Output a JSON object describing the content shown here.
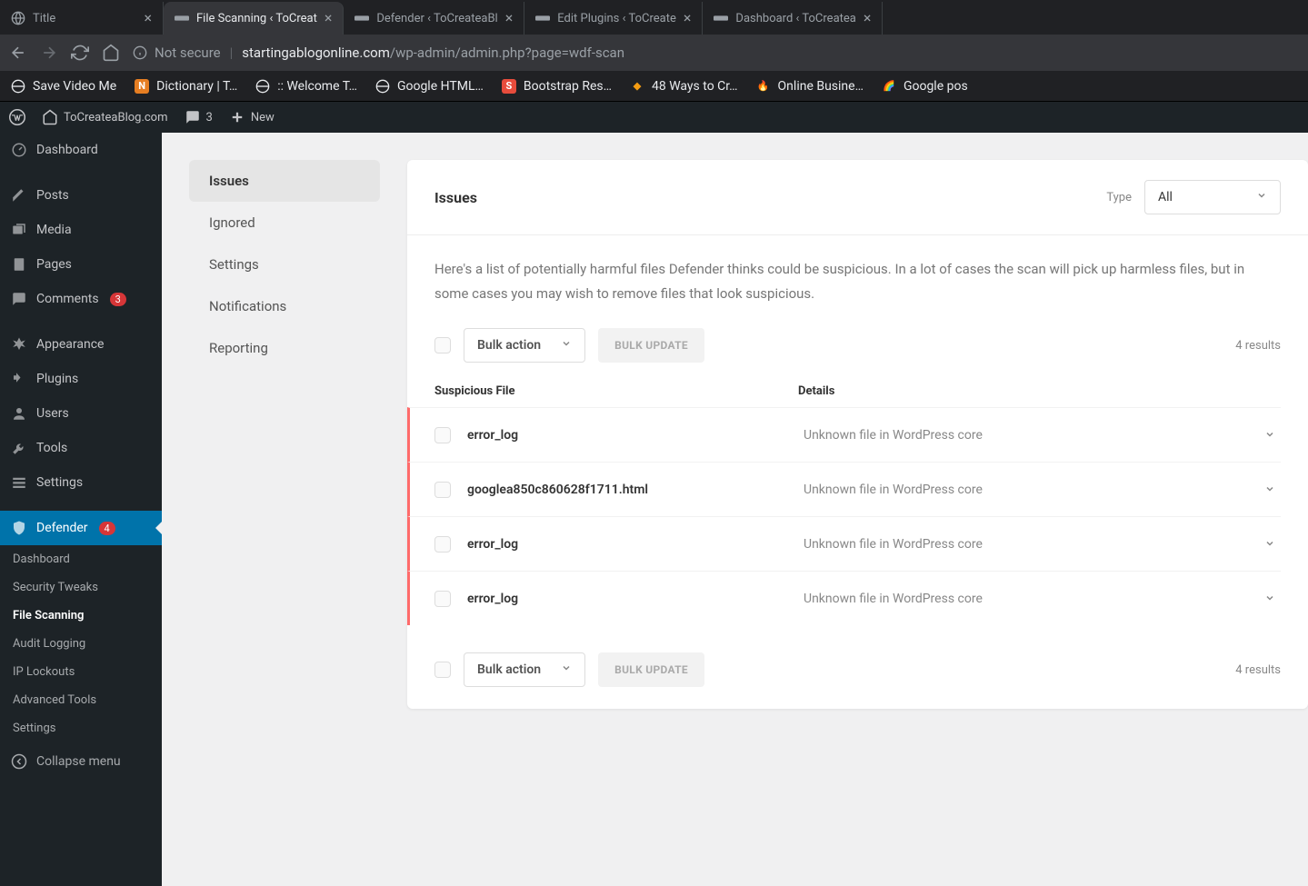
{
  "browser": {
    "tabs": [
      {
        "title": "Title"
      },
      {
        "title": "File Scanning ‹ ToCreat"
      },
      {
        "title": "Defender ‹ ToCreateaBl"
      },
      {
        "title": "Edit Plugins ‹ ToCreate"
      },
      {
        "title": "Dashboard ‹ ToCreatea"
      }
    ],
    "url_secure_label": "Not secure",
    "url_domain": "startingablogonline.com",
    "url_path": "/wp-admin/admin.php?page=wdf-scan",
    "bookmarks": [
      {
        "label": "Save Video Me"
      },
      {
        "label": "Dictionary | T…"
      },
      {
        "label": ":: Welcome T…"
      },
      {
        "label": "Google HTML…"
      },
      {
        "label": "Bootstrap Res…"
      },
      {
        "label": "48 Ways to Cr…"
      },
      {
        "label": "Online Busine…"
      },
      {
        "label": "Google pos"
      }
    ]
  },
  "wp_bar": {
    "site": "ToCreateaBlog.com",
    "comments": "3",
    "new": "New"
  },
  "wp_menu": {
    "items": [
      {
        "label": "Dashboard"
      },
      {
        "label": "Posts"
      },
      {
        "label": "Media"
      },
      {
        "label": "Pages"
      },
      {
        "label": "Comments",
        "badge": "3"
      },
      {
        "label": "Appearance"
      },
      {
        "label": "Plugins"
      },
      {
        "label": "Users"
      },
      {
        "label": "Tools"
      },
      {
        "label": "Settings"
      },
      {
        "label": "Defender",
        "badge": "4"
      }
    ],
    "submenu": [
      {
        "label": "Dashboard"
      },
      {
        "label": "Security Tweaks"
      },
      {
        "label": "File Scanning"
      },
      {
        "label": "Audit Logging"
      },
      {
        "label": "IP Lockouts"
      },
      {
        "label": "Advanced Tools"
      },
      {
        "label": "Settings"
      }
    ],
    "collapse": "Collapse menu"
  },
  "side_nav": {
    "items": [
      {
        "label": "Issues"
      },
      {
        "label": "Ignored"
      },
      {
        "label": "Settings"
      },
      {
        "label": "Notifications"
      },
      {
        "label": "Reporting"
      }
    ]
  },
  "panel": {
    "title": "Issues",
    "type_label": "Type",
    "type_value": "All",
    "description": "Here's a list of potentially harmful files Defender thinks could be suspicious. In a lot of cases the scan will pick up harmless files, but in some cases you may wish to  remove files that look suspicious.",
    "bulk_action": "Bulk action",
    "bulk_update": "BULK UPDATE",
    "results": "4 results",
    "col_file": "Suspicious File",
    "col_details": "Details",
    "rows": [
      {
        "file": "error_log",
        "detail": "Unknown file in WordPress core"
      },
      {
        "file": "googlea850c860628f1711.html",
        "detail": "Unknown file in WordPress core"
      },
      {
        "file": "error_log",
        "detail": "Unknown file in WordPress core"
      },
      {
        "file": "error_log",
        "detail": "Unknown file in WordPress core"
      }
    ]
  }
}
